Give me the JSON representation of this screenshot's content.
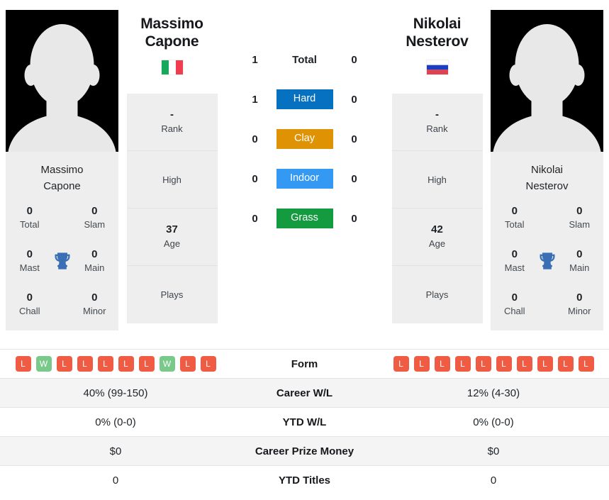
{
  "players": {
    "left": {
      "first_name": "Massimo",
      "last_name": "Capone",
      "full_name_line1": "Massimo",
      "full_name_line2": "Capone",
      "country": "Italy",
      "flag_icon": "flag-italy-icon",
      "avatar_icon": "player-silhouette-avatar",
      "titles": {
        "total": "0",
        "slam": "0",
        "mast": "0",
        "main": "0",
        "chall": "0",
        "minor": "0",
        "labels": {
          "total": "Total",
          "slam": "Slam",
          "mast": "Mast",
          "main": "Main",
          "chall": "Chall",
          "minor": "Minor"
        },
        "trophy_icon": "trophy-icon"
      },
      "info": {
        "rank_value": "-",
        "rank_label": "Rank",
        "high_value": "",
        "high_label": "High",
        "age_value": "37",
        "age_label": "Age",
        "plays_value": "",
        "plays_label": "Plays"
      }
    },
    "right": {
      "first_name": "Nikolai",
      "last_name": "Nesterov",
      "full_name_line1": "Nikolai",
      "full_name_line2": "Nesterov",
      "country": "Russia",
      "flag_icon": "flag-russia-icon",
      "avatar_icon": "player-silhouette-avatar",
      "titles": {
        "total": "0",
        "slam": "0",
        "mast": "0",
        "main": "0",
        "chall": "0",
        "minor": "0",
        "labels": {
          "total": "Total",
          "slam": "Slam",
          "mast": "Mast",
          "main": "Main",
          "chall": "Chall",
          "minor": "Minor"
        },
        "trophy_icon": "trophy-icon"
      },
      "info": {
        "rank_value": "-",
        "rank_label": "Rank",
        "high_value": "",
        "high_label": "High",
        "age_value": "42",
        "age_label": "Age",
        "plays_value": "",
        "plays_label": "Plays"
      }
    }
  },
  "head_to_head": {
    "rows": [
      {
        "label": "Total",
        "left": "1",
        "right": "0",
        "chip": false,
        "color": ""
      },
      {
        "label": "Hard",
        "left": "1",
        "right": "0",
        "chip": true,
        "color": "#0571c0"
      },
      {
        "label": "Clay",
        "left": "0",
        "right": "0",
        "chip": true,
        "color": "#e09205"
      },
      {
        "label": "Indoor",
        "left": "0",
        "right": "0",
        "chip": true,
        "color": "#3399f3"
      },
      {
        "label": "Grass",
        "left": "0",
        "right": "0",
        "chip": true,
        "color": "#149a3f"
      }
    ]
  },
  "comparison_table": {
    "form": {
      "label": "Form",
      "left": [
        "L",
        "W",
        "L",
        "L",
        "L",
        "L",
        "L",
        "W",
        "L",
        "L"
      ],
      "right": [
        "L",
        "L",
        "L",
        "L",
        "L",
        "L",
        "L",
        "L",
        "L",
        "L"
      ]
    },
    "rows": [
      {
        "label": "Career W/L",
        "left": "40% (99-150)",
        "right": "12% (4-30)"
      },
      {
        "label": "YTD W/L",
        "left": "0% (0-0)",
        "right": "0% (0-0)"
      },
      {
        "label": "Career Prize Money",
        "left": "$0",
        "right": "$0"
      },
      {
        "label": "YTD Titles",
        "left": "0",
        "right": "0"
      }
    ]
  },
  "colors": {
    "hard": "#0571c0",
    "clay": "#e09205",
    "indoor": "#3399f3",
    "grass": "#149a3f",
    "loss": "#f05b43",
    "win": "#79c98a",
    "trophy": "#3a6fb5",
    "card_bg": "#eeeeee",
    "stripe_bg": "#f4f4f4"
  }
}
